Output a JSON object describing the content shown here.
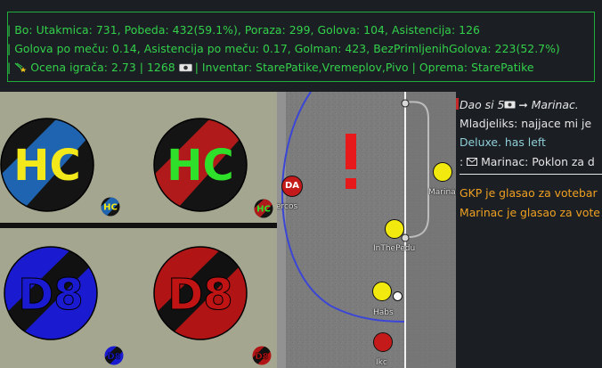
{
  "stats": {
    "line1": "| Bo: Utakmica: 731, Pobeda: 432(59.1%), Poraza: 299, Golova: 104, Asistencija: 126",
    "line2": "| Golova po meču: 0.14, Asistencija po meču: 0.17, Golman: 423, BezPrimljenihGolova: 223(52.7%)",
    "line3_prefix": "| ",
    "line3_icon": "shooting-star-icon",
    "line3_rating": " Ocena igrača: 2.73 | 1268 ",
    "line3_money_icon": "banknote-icon",
    "line3_suffix": " | Inventar: StarePatike,Vremeplov,Pivo | Oprema: StarePatike",
    "color": "#33d14a"
  },
  "logos": {
    "top_left": {
      "text": "HC",
      "small": "HC",
      "stripe": "#1f64b0",
      "text_color": "#f2e81a"
    },
    "top_right": {
      "text": "HC",
      "small": "HC",
      "stripe": "#b01a1a",
      "text_color": "#2fe02a"
    },
    "bottom_left": {
      "text": "D8",
      "small": "D8",
      "stripe": "#111111",
      "circle": "#1a1ad0",
      "text_color": "#1a1ad0"
    },
    "bottom_right": {
      "text": "D8",
      "small": "D8",
      "stripe": "#111111",
      "circle": "#b01414",
      "text_color": "#c01414"
    }
  },
  "field": {
    "exclamation": "!",
    "players": [
      {
        "name": "ercos",
        "avatar": "DA",
        "team": "red"
      },
      {
        "name": "Marinac",
        "avatar": "",
        "team": "yellow"
      },
      {
        "name": "InThePedu",
        "avatar": "",
        "team": "yellow"
      },
      {
        "name": "Habs",
        "avatar": "",
        "team": "yellow"
      },
      {
        "name": "Ikc",
        "avatar": "",
        "team": "red"
      }
    ]
  },
  "chat": {
    "line1_text": " Dao si 5",
    "line1_arrow": "➞",
    "line1_target": " Marinac.",
    "line2": "Mladjeliks: najjace mi je",
    "line3": "Deluxe. has left",
    "line4_prefix": ": ",
    "line4_text": " Marinac: Poklon za d",
    "line5": "GKP je glasao za votebar",
    "line6": "Marinac je glasao za vote"
  }
}
